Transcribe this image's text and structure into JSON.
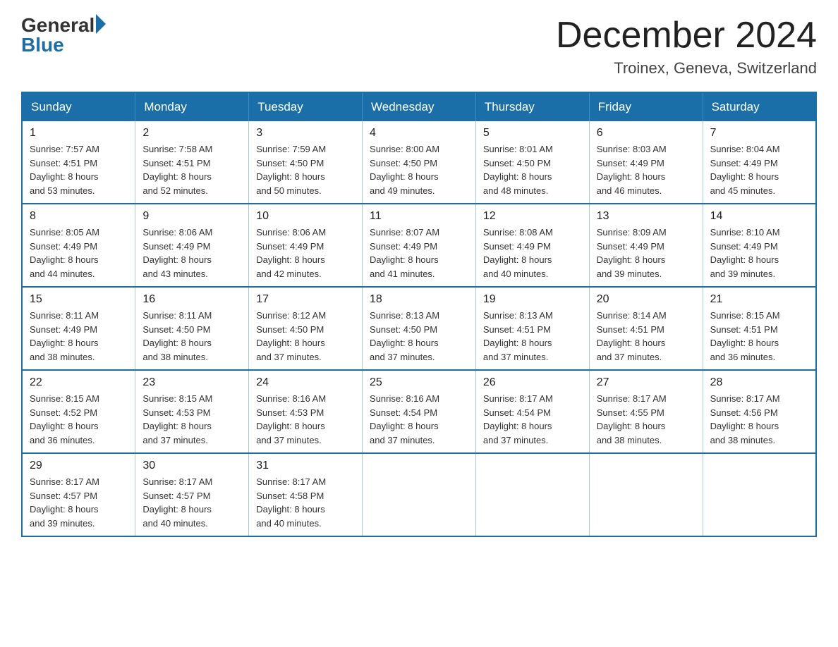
{
  "header": {
    "logo_general": "General",
    "logo_blue": "Blue",
    "month_title": "December 2024",
    "location": "Troinex, Geneva, Switzerland"
  },
  "days_of_week": [
    "Sunday",
    "Monday",
    "Tuesday",
    "Wednesday",
    "Thursday",
    "Friday",
    "Saturday"
  ],
  "weeks": [
    [
      {
        "day": "1",
        "sunrise": "7:57 AM",
        "sunset": "4:51 PM",
        "daylight": "8 hours and 53 minutes."
      },
      {
        "day": "2",
        "sunrise": "7:58 AM",
        "sunset": "4:51 PM",
        "daylight": "8 hours and 52 minutes."
      },
      {
        "day": "3",
        "sunrise": "7:59 AM",
        "sunset": "4:50 PM",
        "daylight": "8 hours and 50 minutes."
      },
      {
        "day": "4",
        "sunrise": "8:00 AM",
        "sunset": "4:50 PM",
        "daylight": "8 hours and 49 minutes."
      },
      {
        "day": "5",
        "sunrise": "8:01 AM",
        "sunset": "4:50 PM",
        "daylight": "8 hours and 48 minutes."
      },
      {
        "day": "6",
        "sunrise": "8:03 AM",
        "sunset": "4:49 PM",
        "daylight": "8 hours and 46 minutes."
      },
      {
        "day": "7",
        "sunrise": "8:04 AM",
        "sunset": "4:49 PM",
        "daylight": "8 hours and 45 minutes."
      }
    ],
    [
      {
        "day": "8",
        "sunrise": "8:05 AM",
        "sunset": "4:49 PM",
        "daylight": "8 hours and 44 minutes."
      },
      {
        "day": "9",
        "sunrise": "8:06 AM",
        "sunset": "4:49 PM",
        "daylight": "8 hours and 43 minutes."
      },
      {
        "day": "10",
        "sunrise": "8:06 AM",
        "sunset": "4:49 PM",
        "daylight": "8 hours and 42 minutes."
      },
      {
        "day": "11",
        "sunrise": "8:07 AM",
        "sunset": "4:49 PM",
        "daylight": "8 hours and 41 minutes."
      },
      {
        "day": "12",
        "sunrise": "8:08 AM",
        "sunset": "4:49 PM",
        "daylight": "8 hours and 40 minutes."
      },
      {
        "day": "13",
        "sunrise": "8:09 AM",
        "sunset": "4:49 PM",
        "daylight": "8 hours and 39 minutes."
      },
      {
        "day": "14",
        "sunrise": "8:10 AM",
        "sunset": "4:49 PM",
        "daylight": "8 hours and 39 minutes."
      }
    ],
    [
      {
        "day": "15",
        "sunrise": "8:11 AM",
        "sunset": "4:49 PM",
        "daylight": "8 hours and 38 minutes."
      },
      {
        "day": "16",
        "sunrise": "8:11 AM",
        "sunset": "4:50 PM",
        "daylight": "8 hours and 38 minutes."
      },
      {
        "day": "17",
        "sunrise": "8:12 AM",
        "sunset": "4:50 PM",
        "daylight": "8 hours and 37 minutes."
      },
      {
        "day": "18",
        "sunrise": "8:13 AM",
        "sunset": "4:50 PM",
        "daylight": "8 hours and 37 minutes."
      },
      {
        "day": "19",
        "sunrise": "8:13 AM",
        "sunset": "4:51 PM",
        "daylight": "8 hours and 37 minutes."
      },
      {
        "day": "20",
        "sunrise": "8:14 AM",
        "sunset": "4:51 PM",
        "daylight": "8 hours and 37 minutes."
      },
      {
        "day": "21",
        "sunrise": "8:15 AM",
        "sunset": "4:51 PM",
        "daylight": "8 hours and 36 minutes."
      }
    ],
    [
      {
        "day": "22",
        "sunrise": "8:15 AM",
        "sunset": "4:52 PM",
        "daylight": "8 hours and 36 minutes."
      },
      {
        "day": "23",
        "sunrise": "8:15 AM",
        "sunset": "4:53 PM",
        "daylight": "8 hours and 37 minutes."
      },
      {
        "day": "24",
        "sunrise": "8:16 AM",
        "sunset": "4:53 PM",
        "daylight": "8 hours and 37 minutes."
      },
      {
        "day": "25",
        "sunrise": "8:16 AM",
        "sunset": "4:54 PM",
        "daylight": "8 hours and 37 minutes."
      },
      {
        "day": "26",
        "sunrise": "8:17 AM",
        "sunset": "4:54 PM",
        "daylight": "8 hours and 37 minutes."
      },
      {
        "day": "27",
        "sunrise": "8:17 AM",
        "sunset": "4:55 PM",
        "daylight": "8 hours and 38 minutes."
      },
      {
        "day": "28",
        "sunrise": "8:17 AM",
        "sunset": "4:56 PM",
        "daylight": "8 hours and 38 minutes."
      }
    ],
    [
      {
        "day": "29",
        "sunrise": "8:17 AM",
        "sunset": "4:57 PM",
        "daylight": "8 hours and 39 minutes."
      },
      {
        "day": "30",
        "sunrise": "8:17 AM",
        "sunset": "4:57 PM",
        "daylight": "8 hours and 40 minutes."
      },
      {
        "day": "31",
        "sunrise": "8:17 AM",
        "sunset": "4:58 PM",
        "daylight": "8 hours and 40 minutes."
      },
      null,
      null,
      null,
      null
    ]
  ],
  "labels": {
    "sunrise_prefix": "Sunrise: ",
    "sunset_prefix": "Sunset: ",
    "daylight_prefix": "Daylight: "
  }
}
